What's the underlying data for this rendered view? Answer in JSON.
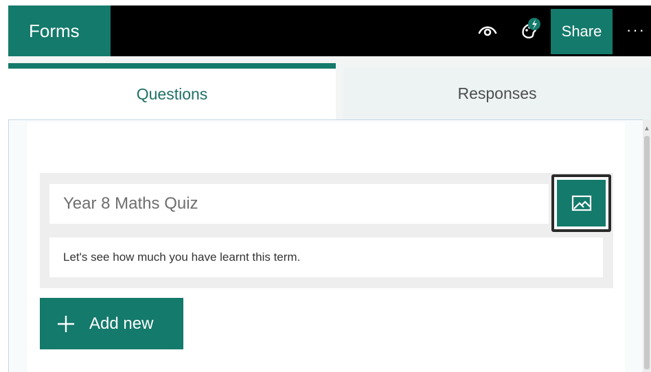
{
  "app": {
    "brand": "Forms",
    "colors": {
      "accent": "#147a6b",
      "topbar": "#000000"
    }
  },
  "toolbar": {
    "preview_icon": "eye-icon",
    "theme_icon": "palette-icon",
    "share_label": "Share",
    "more_label": "···"
  },
  "tabs": [
    {
      "label": "Questions",
      "selected": true
    },
    {
      "label": "Responses",
      "selected": false
    }
  ],
  "form": {
    "title": "Year 8 Maths Quiz",
    "description": "Let's see how much you have learnt this term.",
    "image_button_icon": "image-icon"
  },
  "actions": {
    "add_new_label": "Add new"
  }
}
